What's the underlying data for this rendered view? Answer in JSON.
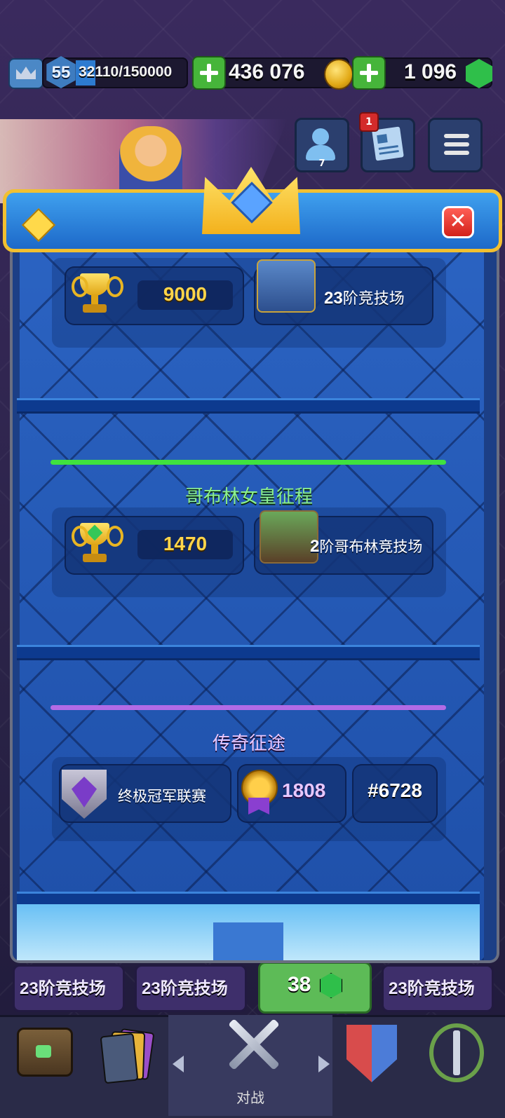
{
  "topbar": {
    "level": "55",
    "xp": "32110/150000",
    "gold": "436 076",
    "gems": "1 096"
  },
  "header_icons": {
    "friends_count": "7",
    "news_badge": "1"
  },
  "sections": {
    "ranked": {
      "trophies": "9000",
      "arena_num": "23",
      "arena_text": "阶竞技场"
    },
    "goblin": {
      "title": "哥布林女皇征程",
      "trophies": "1470",
      "arena_num": "2",
      "arena_text": "阶哥布林竞技场",
      "bar_color": "#3fe23f"
    },
    "legend": {
      "title": "传奇征途",
      "league": "终极冠军联赛",
      "rating": "1808",
      "rank": "#6728",
      "bar_color": "#b26be6"
    }
  },
  "bottom_cards": {
    "c1_num": "23",
    "c1_text": "阶竞技场",
    "c2_num": "23",
    "c2_text": "阶竞技场",
    "c3_value": "38",
    "c4_num": "23",
    "c4_text": "阶竞技场"
  },
  "nav": {
    "battle_label": "对战",
    "items": [
      "chest-icon",
      "cards-icon",
      "swords-icon",
      "clan-icon",
      "events-icon"
    ]
  },
  "colors": {
    "modal_blue": "#2b63c2",
    "header_gold": "#f2c030",
    "close_red": "#d2211a",
    "number_gold": "#ffd54a",
    "legend_purple": "#8a3fd0"
  }
}
